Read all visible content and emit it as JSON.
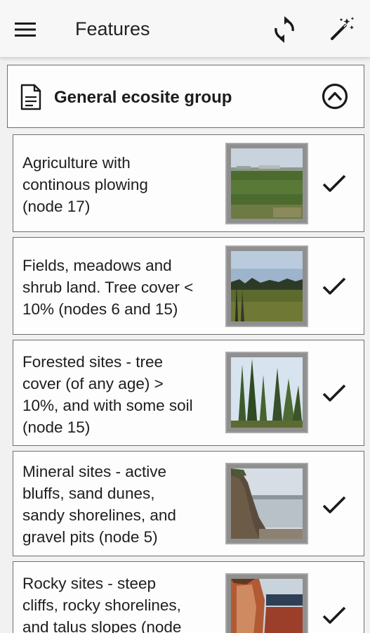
{
  "appbar": {
    "title": "Features",
    "menu_icon": "hamburger-menu-icon",
    "sync_icon": "sync-icon",
    "magic_icon": "magic-wand-icon"
  },
  "group": {
    "title": "General ecosite group",
    "doc_icon": "document-icon",
    "collapse_icon": "chevron-up-circle-icon"
  },
  "items": [
    {
      "lines": [
        "Agriculture with",
        "continous plowing",
        "(node 17)"
      ],
      "checked": true
    },
    {
      "lines": [
        "Fields, meadows and",
        "shrub land. Tree cover <",
        "10% (nodes 6 and 15)"
      ],
      "checked": true
    },
    {
      "lines": [
        "Forested sites - tree",
        "cover (of any age) >",
        "10%, and with some soil",
        "(node 15)"
      ],
      "checked": true
    },
    {
      "lines": [
        "Mineral sites - active",
        "bluffs, sand dunes,",
        "sandy shorelines, and",
        "gravel pits (node 5)"
      ],
      "checked": true
    },
    {
      "lines": [
        "Rocky sites - steep",
        "cliffs, rocky shorelines,",
        "and talus slopes (node"
      ],
      "checked": true
    }
  ],
  "colors": {
    "appbar_bg": "#f7f7f7",
    "page_bg": "#f1f1f1",
    "card_border": "#6f6f6f",
    "icon_color": "#1a1a1a"
  }
}
